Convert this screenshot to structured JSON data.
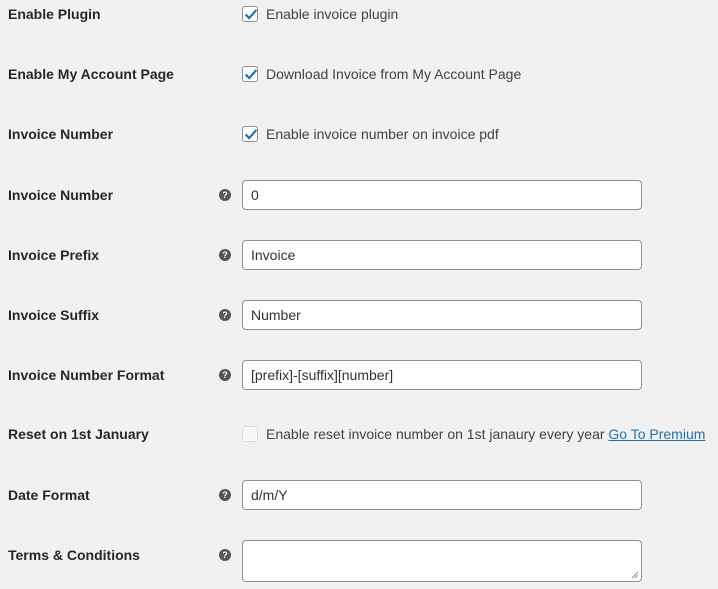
{
  "settings": {
    "enable_plugin": {
      "label": "Enable Plugin",
      "checkbox_text": "Enable invoice plugin",
      "checked": true
    },
    "enable_my_account": {
      "label": "Enable My Account Page",
      "checkbox_text": "Download Invoice from My Account Page",
      "checked": true
    },
    "invoice_number_toggle": {
      "label": "Invoice Number",
      "checkbox_text": "Enable invoice number on invoice pdf",
      "checked": true
    },
    "invoice_number": {
      "label": "Invoice Number",
      "help_icon": "question-icon",
      "value": "0"
    },
    "invoice_prefix": {
      "label": "Invoice Prefix",
      "help_icon": "question-icon",
      "value": "Invoice"
    },
    "invoice_suffix": {
      "label": "Invoice Suffix",
      "help_icon": "question-icon",
      "value": "Number"
    },
    "invoice_number_format": {
      "label": "Invoice Number Format",
      "help_icon": "question-icon",
      "value": "[prefix]-[suffix][number]"
    },
    "reset_january": {
      "label": "Reset on 1st January",
      "checkbox_text": "Enable reset invoice number on 1st janaury every year",
      "link_text": "Go To Premium",
      "checked": false,
      "disabled": true
    },
    "date_format": {
      "label": "Date Format",
      "help_icon": "question-icon",
      "value": "d/m/Y"
    },
    "terms_conditions": {
      "label": "Terms & Conditions",
      "help_icon": "question-icon",
      "value": ""
    }
  },
  "colors": {
    "background": "#f1f1f1",
    "checkmark": "#2271b1",
    "link": "#2271b1"
  }
}
